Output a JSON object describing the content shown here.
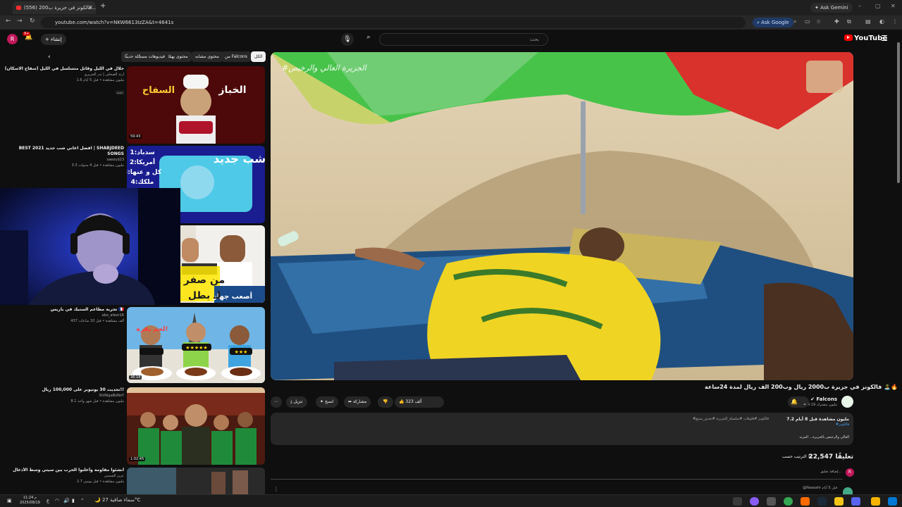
{
  "browser": {
    "tab_title": "(556) فالكونز في جزيرة ب200...",
    "new_tab": "+",
    "ask_gemini": "Ask Gemini",
    "url": "youtube.com/watch?v=NKW6613IzZA&t=4641s",
    "ask_google": "Ask Google",
    "window_min": "–",
    "window_max": "▢",
    "window_close": "✕"
  },
  "header": {
    "logo": "YouTube",
    "search_placeholder": "بحث",
    "create_label": "إنشاء",
    "avatar_letter": "R",
    "notif_count": "9+"
  },
  "chips": [
    {
      "label": "الكل",
      "active": true
    },
    {
      "label": "من Falcons",
      "active": false
    },
    {
      "label": "محتوى مشابه",
      "active": false
    },
    {
      "label": "محتوى يهمّك",
      "active": false
    },
    {
      "label": "فيديوهات مسجّلة حديثًا",
      "active": false
    }
  ],
  "recommendations": [
    {
      "title": "حلال في الليل وقاتل متسلسل في الليل (سفاح الاسكان)",
      "channel": "ارثة الصحاف | بدر الجزيري",
      "stats": "1.6 مليون مشاهدة • قبل 5 أيام",
      "duration": "59:43",
      "badge": "جديد"
    },
    {
      "title": "BEST 2021 افضل اغاني شب جديد | SHABJDEED SONGS",
      "channel": "saeoud23",
      "stats": "3.3 مليون مشاهدة • قبل 4 سنوات",
      "duration": "",
      "badge": ""
    },
    {
      "title": "",
      "channel": "",
      "stats": "",
      "duration": "",
      "badge": ""
    },
    {
      "title": "تجربة مطاعم الستيك في باريس 🇫🇷",
      "channel": "abo_ateer16",
      "stats": "437 ألف مشاهدة • قبل 10 ساعات",
      "duration": "36:18",
      "badge": ""
    },
    {
      "title": "تحديت 30 يوتيوبر على 100,000 ريال!!",
      "channel": "ShiNigaBoNoY",
      "stats": "8.1 مليون مشاهدة • قبل شهر واحد",
      "duration": "1:02:45",
      "badge": ""
    },
    {
      "title": "أنشئوا مقاومة وأعلنوا الحرب بين سيتي وسط الأدغال",
      "channel": "عزيز الشمس",
      "stats": "2.7 مليون مشاهدة • قبل يومين",
      "duration": "",
      "badge": ""
    }
  ],
  "player": {
    "watermark": "#الجزيرة الغالي والرخيص"
  },
  "video": {
    "title": "فالكونز في جزيرة ب2000 ريال وب200 الف ريال لمدة 24ساعة 🏝️🔥",
    "channel": "Falcons",
    "subscribers": "4.19 مليون مشترك",
    "likes": "323 ألف",
    "share_label": "مشاركة",
    "clip_label": "انسخ",
    "download_label": "تنزيل",
    "more_label": "⋯",
    "description": {
      "views_date": "7.2 مليون مشاهدة قبل 8 أيام",
      "hashtags": "#فالكونز #فلوقات #سلسلة_الجزيرة #تحدي_ممتع",
      "hashtag2": "#فالكونز",
      "snippet": "الغالي والرخيص بالجزيرة... المزيد"
    }
  },
  "comments": {
    "count": "22,547 تعليقًا",
    "sort_label": "الترتيب حسب",
    "add_placeholder": "إضافة تعليق...",
    "first_author": "@Naasahr قبل 5 أيام"
  },
  "taskbar": {
    "time": "11:24 م",
    "date": "2025/08/19",
    "weather": "سماء صافية  27°C"
  },
  "colors": {
    "bg": "#0f0f0f",
    "surface": "#272727",
    "yt_red": "#ff0000",
    "link": "#3ea6ff"
  }
}
